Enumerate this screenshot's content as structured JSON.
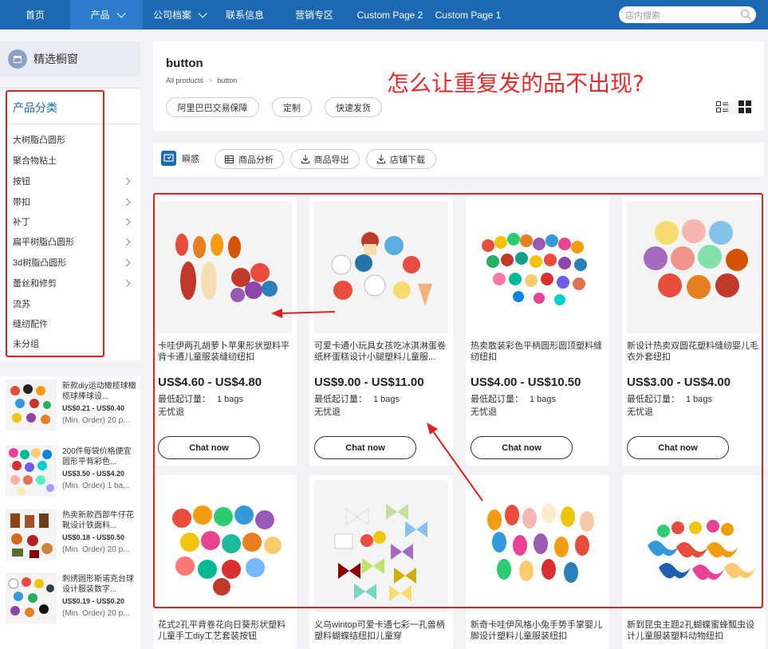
{
  "nav": {
    "items": [
      {
        "label": "首页"
      },
      {
        "label": "产品"
      },
      {
        "label": "公司档案"
      },
      {
        "label": "联系信息"
      },
      {
        "label": "营销专区"
      },
      {
        "label": "Custom Page 2"
      },
      {
        "label": "Custom Page 1"
      }
    ],
    "search_placeholder": "店内搜索",
    "accent": "#1d68b3"
  },
  "showcase": {
    "label": "精选橱窗"
  },
  "categories": {
    "title": "产品分类",
    "items": [
      {
        "label": "大树脂凸圆形"
      },
      {
        "label": "聚合物粘土"
      },
      {
        "label": "按钮"
      },
      {
        "label": "带扣"
      },
      {
        "label": "补丁"
      },
      {
        "label": "扁平树脂凸圆形"
      },
      {
        "label": "3d树脂凸圆形"
      },
      {
        "label": "蕾丝和修剪"
      },
      {
        "label": "流苏"
      },
      {
        "label": "缝纫配件"
      },
      {
        "label": "未分组"
      }
    ]
  },
  "mini_products": [
    {
      "title": "新款diy运动橄榄球橄榄球棒球设...",
      "price": "US$0.21 - US$0.40",
      "order": "(Min. Order) 20 p..."
    },
    {
      "title": "200件每袋价格便宜圆形平背彩色...",
      "price": "US$3.50 - US$4.20",
      "order": "(Min. Order) 1 ba..."
    },
    {
      "title": "热卖新款西部牛仔花靴设计铁面料...",
      "price": "US$0.18 - US$0.50",
      "order": "(Min. Order) 20 p..."
    },
    {
      "title": "刺绣圆形斯诺克台球设计服装数字...",
      "price": "US$0.19 - US$0.20",
      "order": "(Min. Order) 20 p..."
    }
  ],
  "header": {
    "title": "button",
    "breadcrumb": {
      "root": "All products",
      "sep": ">",
      "current": "button"
    },
    "tags": [
      "阿里巴巴交易保障",
      "定制",
      "快速发货"
    ],
    "annotation": "怎么让重复发的品不出现?"
  },
  "toolbar": {
    "first": "瞬惑",
    "buttons": [
      "商品分析",
      "商品导出",
      "店铺下载"
    ]
  },
  "products": [
    {
      "title": "卡哇伊两孔胡萝卜苹果形状塑料平背卡通儿童服装缝纫纽扣",
      "price": "US$4.60 - US$4.80",
      "moq_label": "最低起订量：",
      "moq": "1 bags",
      "ret": "无忧退",
      "chat": "Chat now"
    },
    {
      "title": "可爱卡通小玩具女孩吃冰淇淋蛋卷纸杯蛋糕设计小腿塑料儿童服...",
      "price": "US$9.00 - US$11.00",
      "moq_label": "最低起订量：",
      "moq": "1 bags",
      "ret": "无忧退",
      "chat": "Chat now"
    },
    {
      "title": "热卖散装彩色平柄圆形圆顶塑料缝纫纽扣",
      "price": "US$4.00 - US$10.50",
      "moq_label": "最低起订量：",
      "moq": "1 bags",
      "ret": "无忧退",
      "chat": "Chat now"
    },
    {
      "title": "新设计热卖双圆花塑料缝纫婴儿毛衣外套纽扣",
      "price": "US$3.00 - US$4.00",
      "moq_label": "最低起订量：",
      "moq": "1 bags",
      "ret": "无忧退",
      "chat": "Chat now"
    },
    {
      "title": "花式2孔平背卷花向日葵形状塑料儿童手工diy工艺套装按钮"
    },
    {
      "title": "义乌wintop可爱卡通七彩一孔兽柄塑料蝴蝶结纽扣儿童穿"
    },
    {
      "title": "新奇卡哇伊风格小兔手势手掌婴儿脚设计塑料儿童服装纽扣"
    },
    {
      "title": "新到昆虫主题2孔蝴蝶蜜蜂瓢虫设计儿童服装塑料动物纽扣"
    }
  ]
}
